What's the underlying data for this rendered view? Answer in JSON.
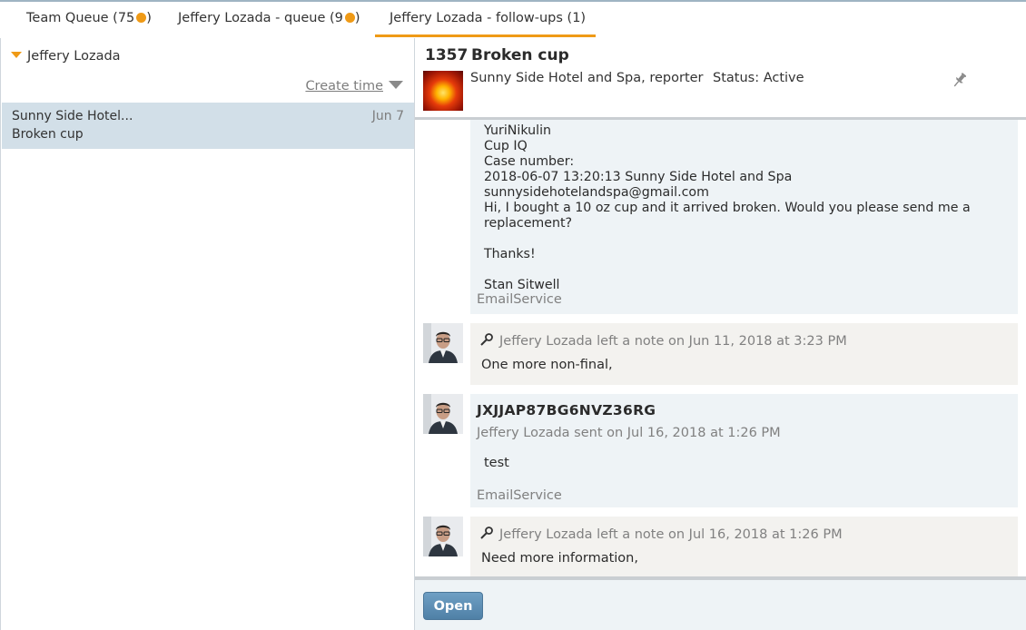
{
  "tabs": [
    {
      "label": "Team Queue (75",
      "suffix": ")"
    },
    {
      "label": "Jeffery Lozada - queue (9",
      "suffix": ")"
    },
    {
      "label": "Jeffery Lozada - follow-ups (1)"
    }
  ],
  "left_panel": {
    "group_label": "Jeffery Lozada",
    "sort_label": "Create time",
    "items": [
      {
        "from": "Sunny Side Hotel...",
        "date": "Jun 7",
        "subject": "Broken cup"
      }
    ]
  },
  "case": {
    "number": "1357",
    "title": "Broken cup",
    "reporter": "Sunny Side Hotel and Spa, reporter",
    "status": "Status: Active"
  },
  "feed": {
    "email1": {
      "body": "YuriNikulin\nCup IQ\nCase number:\n2018-06-07 13:20:13 Sunny Side Hotel and Spa sunnysidehotelandspa@gmail.com\nHi, I bought a 10 oz cup and it arrived broken. Would you please send me a\nreplacement?\n\nThanks!\n\nStan Sitwell",
      "source": "EmailService"
    },
    "note1": {
      "meta": "Jeffery Lozada left a note on Jun 11, 2018 at 3:23 PM",
      "text": "One more non-final,"
    },
    "email2": {
      "subject": "JXJJAP87BG6NVZ36RG",
      "meta": "Jeffery Lozada sent on Jul 16, 2018 at 1:26 PM",
      "body": "test",
      "source": "EmailService"
    },
    "note2": {
      "meta": "Jeffery Lozada left a note on Jul 16, 2018 at 1:26 PM",
      "text": "Need more information,"
    }
  },
  "footer": {
    "open_label": "Open"
  },
  "colors": {
    "accent": "#ef9a16",
    "selected_row": "#d2dfe8",
    "button": "#5b8bb1"
  }
}
